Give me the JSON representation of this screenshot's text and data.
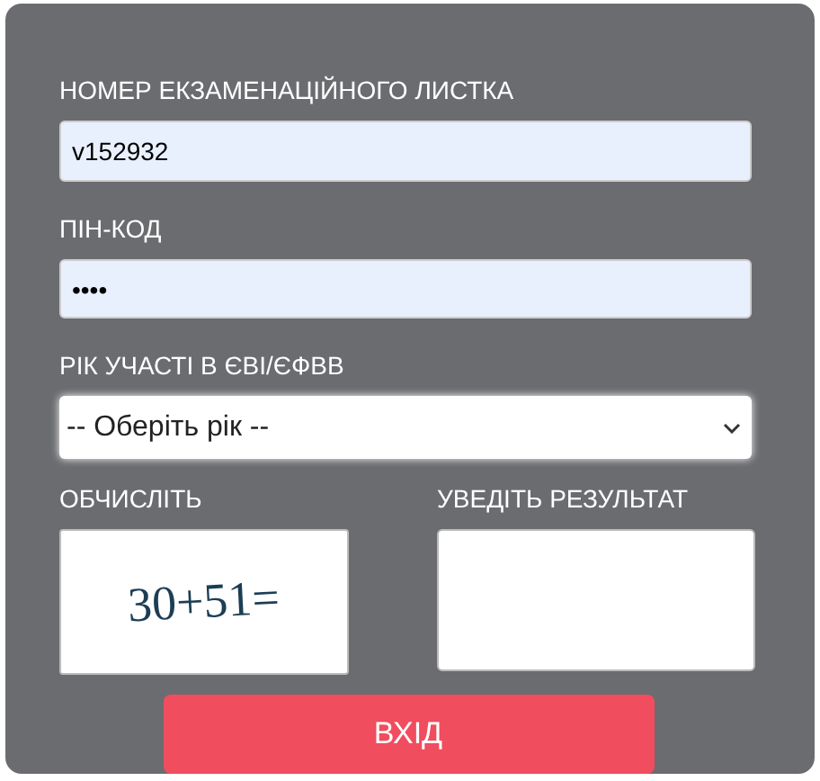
{
  "form": {
    "fields": [
      {
        "kind": "text",
        "label": "НОМЕР ЕКЗАМЕНАЦІЙНОГО ЛИСТКА",
        "value": "v152932"
      },
      {
        "kind": "password",
        "label": "ПІН-КОД",
        "value": "••••"
      },
      {
        "kind": "select",
        "label": "РІК УЧАСТІ В ЄВІ/ЄФВВ",
        "value": "-- Оберіть рік --"
      }
    ],
    "captcha": {
      "label": "ОБЧИСЛІТЬ",
      "expression": "30+51="
    },
    "result": {
      "label": "УВЕДІТЬ РЕЗУЛЬТАТ"
    },
    "submit": "ВХІД"
  }
}
